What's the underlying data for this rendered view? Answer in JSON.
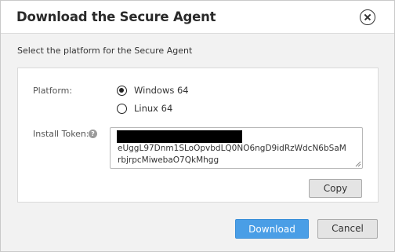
{
  "dialog": {
    "title": "Download the Secure Agent",
    "subtitle": "Select the platform for the Secure Agent"
  },
  "platform": {
    "label": "Platform:",
    "options": [
      {
        "label": "Windows 64",
        "selected": true
      },
      {
        "label": "Linux 64",
        "selected": false
      }
    ]
  },
  "install_token": {
    "label": "Install Token:",
    "help_icon_glyph": "?",
    "value_lines": [
      "eUggL97Dnm1SLoOpvbdLQ0NO6ngD9idRzWdcN6bSaM",
      "rbjrpcMiwebaO7QkMhgg"
    ]
  },
  "buttons": {
    "copy": "Copy",
    "download": "Download",
    "cancel": "Cancel"
  },
  "colors": {
    "primary": "#4a9ee6",
    "background": "#f2f2f2"
  }
}
